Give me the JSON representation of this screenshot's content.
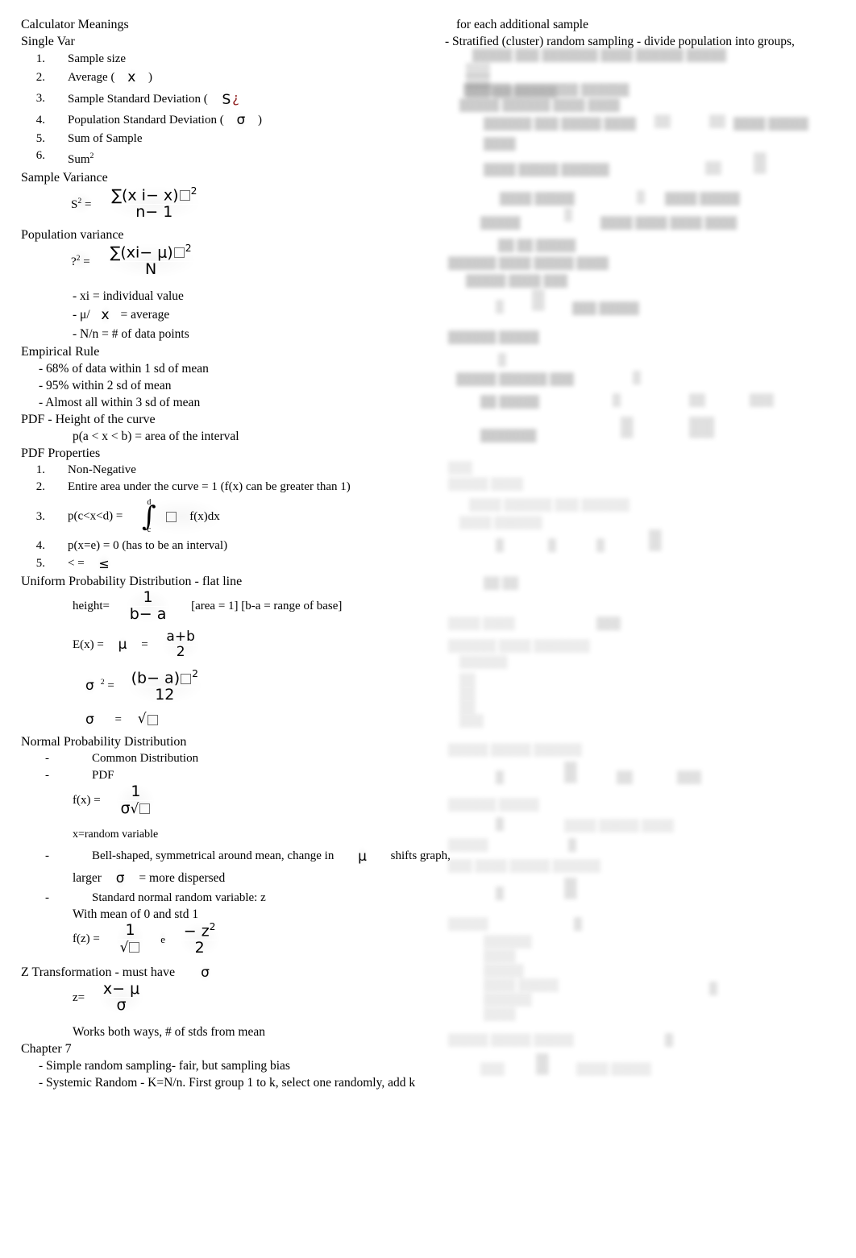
{
  "document": {
    "title": "Calculator Meanings",
    "background_color": "#ffffff",
    "text_color": "#000000",
    "accent_color": "#8c1919"
  },
  "left_column": {
    "heading_calculator_meanings": "Calculator Meanings",
    "subheading_single_var": "Single Var",
    "single_var_items": [
      {
        "num": "1.",
        "text": "Sample size"
      },
      {
        "num": "2.",
        "text_before": "Average (",
        "symbol": "x",
        "text_after": ")"
      },
      {
        "num": "3.",
        "text_before": "Sample Standard Deviation (",
        "symbol": "S",
        "extra": "¿"
      },
      {
        "num": "4.",
        "text_before": "Population Standard Deviation (",
        "symbol": "σ",
        "text_after": ")"
      },
      {
        "num": "5.",
        "text": "Sum of Sample"
      },
      {
        "num": "6.",
        "text": "Sum",
        "sup": "2"
      }
    ],
    "heading_sample_variance": "Sample Variance",
    "sample_variance_formula": {
      "lhs": "S",
      "lhs_sup": "2",
      "equals": "=",
      "numerator": "∑(x i− x)",
      "numerator_box_sup": "2",
      "denominator": "n− 1"
    },
    "heading_population_variance": "Population variance",
    "population_variance_formula": {
      "lhs": "?",
      "lhs_sup": "2",
      "equals": "=",
      "numerator": "∑(xi− μ)",
      "numerator_box_sup": "2",
      "denominator": "N"
    },
    "variance_notes": [
      "- xi = individual value",
      "- N/n = # of data points"
    ],
    "mu_note": {
      "prefix": "- μ/",
      "symbol": "x",
      "suffix": "= average"
    },
    "heading_empirical_rule": "Empirical Rule",
    "empirical_rule_items": [
      "- 68% of data within 1 sd of mean",
      "- 95% within 2 sd of mean",
      "- Almost all within 3 sd of mean"
    ],
    "heading_pdf_height": "PDF - Height of the curve",
    "pdf_height_note": "p(a < x < b) = area of the interval",
    "heading_pdf_properties": "PDF Properties",
    "pdf_properties": [
      {
        "num": "1.",
        "text": "Non-Negative"
      },
      {
        "num": "2.",
        "text": "Entire area under the curve = 1 (f(x) can be greater than 1)"
      },
      {
        "num": "3.",
        "text": "p(c<x<d) =",
        "integral_upper": "d",
        "integral_lower": "c",
        "integral_tail": "f(x)dx"
      },
      {
        "num": "4.",
        "text": "p(x=e) = 0 (has to be an interval)"
      },
      {
        "num": "5.",
        "text": "< =",
        "symbol": "≤"
      }
    ],
    "heading_uniform": "Uniform Probability Distribution - flat line",
    "uniform_height_formula": {
      "lhs": "height=",
      "numerator": "1",
      "denominator": "b− a",
      "note": "[area = 1] [b-a = range of base]"
    },
    "uniform_expected_value": {
      "lhs": "E(x) =",
      "symbol": "μ",
      "equals": "=",
      "numerator": "a+b",
      "denominator": "2"
    },
    "uniform_variance": {
      "lhs": "σ",
      "lhs_sup": "2",
      "equals": "=",
      "numerator": "(b− a)",
      "numerator_box_sup": "2",
      "denominator": "12"
    },
    "uniform_sd": {
      "lhs": "σ",
      "equals": "=",
      "rhs_radical": "√"
    },
    "heading_normal": "Normal Probability Distribution",
    "normal_items": [
      {
        "dash": "-",
        "text": "Common Distribution"
      },
      {
        "dash": "-",
        "text": "PDF"
      }
    ],
    "normal_pdf_formula": {
      "lhs": "f(x) =",
      "numerator": "1",
      "denominator_sigma": "σ",
      "denominator_radical": "√"
    },
    "normal_pdf_note": "x=random variable",
    "normal_bell_note": {
      "dash": "-",
      "text_before": "Bell-shaped, symmetrical around mean, change in",
      "symbol": "μ",
      "text_after": "shifts graph,",
      "line2_before": "larger",
      "line2_symbol": "σ",
      "line2_after": "= more dispersed"
    },
    "standard_normal": {
      "dash": "-",
      "line1": "Standard normal random variable: z",
      "line2": "With mean of 0 and std 1"
    },
    "fz_formula": {
      "lhs": "f(z) =",
      "numerator": "1",
      "denominator_radical": "√",
      "e": "e",
      "exp_numerator": "− z",
      "exp_sup": "2",
      "exp_denominator": "2"
    },
    "heading_z_transformation": {
      "text": "Z Transformation - must have",
      "symbol": "σ"
    },
    "z_formula": {
      "lhs": "z=",
      "numerator": "x− μ",
      "denominator": "σ"
    },
    "z_note": "Works both ways, # of stds from mean",
    "heading_chapter7": "Chapter 7",
    "chapter7_items": [
      "- Simple random sampling- fair, but sampling bias",
      "- Systemic Random - K=N/n. First group 1 to k, select one randomly, add k"
    ]
  },
  "right_column": {
    "visible_lines": [
      "for each additional sample",
      "- Stratified (cluster) random sampling - divide population into groups,"
    ],
    "obscured_note": "Remaining right-column content is blurred and illegible in the source image."
  }
}
